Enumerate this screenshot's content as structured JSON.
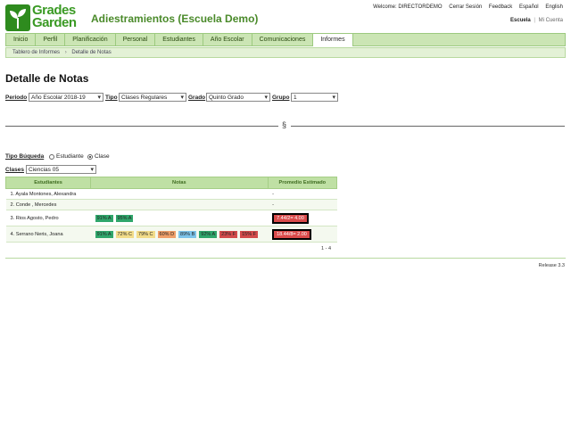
{
  "logo": {
    "line1": "Grades",
    "line2": "Garden"
  },
  "app_title": "Adiestramientos (Escuela Demo)",
  "top_links": {
    "welcome": "Welcome: DIRECTORDEMO",
    "logout": "Cerrar Sesión",
    "feedback": "Feedback",
    "spanish": "Español",
    "english": "English"
  },
  "school_links": {
    "school": "Escuela",
    "separator": "|",
    "account": "Mi Cuenta"
  },
  "nav": {
    "tabs": [
      "Inicio",
      "Perfil",
      "Planificación",
      "Personal",
      "Estudiantes",
      "Año Escolar",
      "Comunicaciones",
      "Informes"
    ],
    "active": "Informes"
  },
  "breadcrumb": {
    "root": "Tablero de Informes",
    "sep": "›",
    "current": "Detalle de Notas"
  },
  "page_title": "Detalle de Notas",
  "filters": {
    "periodo_label": "Periodo",
    "periodo_value": "Año Escolar 2018-19",
    "tipo_label": "Tipo",
    "tipo_value": "Clases Regulares",
    "grado_label": "Grado",
    "grado_value": "Quinto Grado",
    "grupo_label": "Grupo",
    "grupo_value": "1"
  },
  "section_sign": "§",
  "search_type": {
    "label": "Tipo Búqueda",
    "opt_student": "Estudiante",
    "opt_class": "Clase",
    "selected": "Clase"
  },
  "class_select": {
    "label": "Clases",
    "value": "Ciencias 05"
  },
  "table": {
    "headers": {
      "students": "Estudiantes",
      "notes": "Notas",
      "avg": "Promedio Estimado"
    },
    "rows": [
      {
        "name": "1. Ayala Montones, Alexandra",
        "notes": [],
        "avg": "-"
      },
      {
        "name": "2. Conde , Mercedes",
        "notes": [],
        "avg": "-"
      },
      {
        "name": "3. Rios Agosto, Pedro",
        "notes": [
          {
            "text": "91% A",
            "color": "#2fa66b"
          },
          {
            "text": "95% A",
            "color": "#2fa66b"
          }
        ],
        "avg": "7.44/2= 4.00"
      },
      {
        "name": "4. Serrano Neris, Joana",
        "notes": [
          {
            "text": "91% A",
            "color": "#2fa66b"
          },
          {
            "text": "72% C",
            "color": "#f2dc8a"
          },
          {
            "text": "79% C",
            "color": "#f2dc8a"
          },
          {
            "text": "60% D",
            "color": "#f0a06a"
          },
          {
            "text": "89% B",
            "color": "#7ec4ea"
          },
          {
            "text": "92% A",
            "color": "#2fa66b"
          },
          {
            "text": "23% F",
            "color": "#d24b4b"
          },
          {
            "text": "15% F",
            "color": "#d24b4b"
          }
        ],
        "avg": "18.44/8= 2.00"
      }
    ]
  },
  "pager": "1 - 4",
  "release": "Release 3.3",
  "colors": {
    "brand": "#3a9a24",
    "nav_bg": "#cbe5b4",
    "header_bg": "#bfe0a4"
  }
}
